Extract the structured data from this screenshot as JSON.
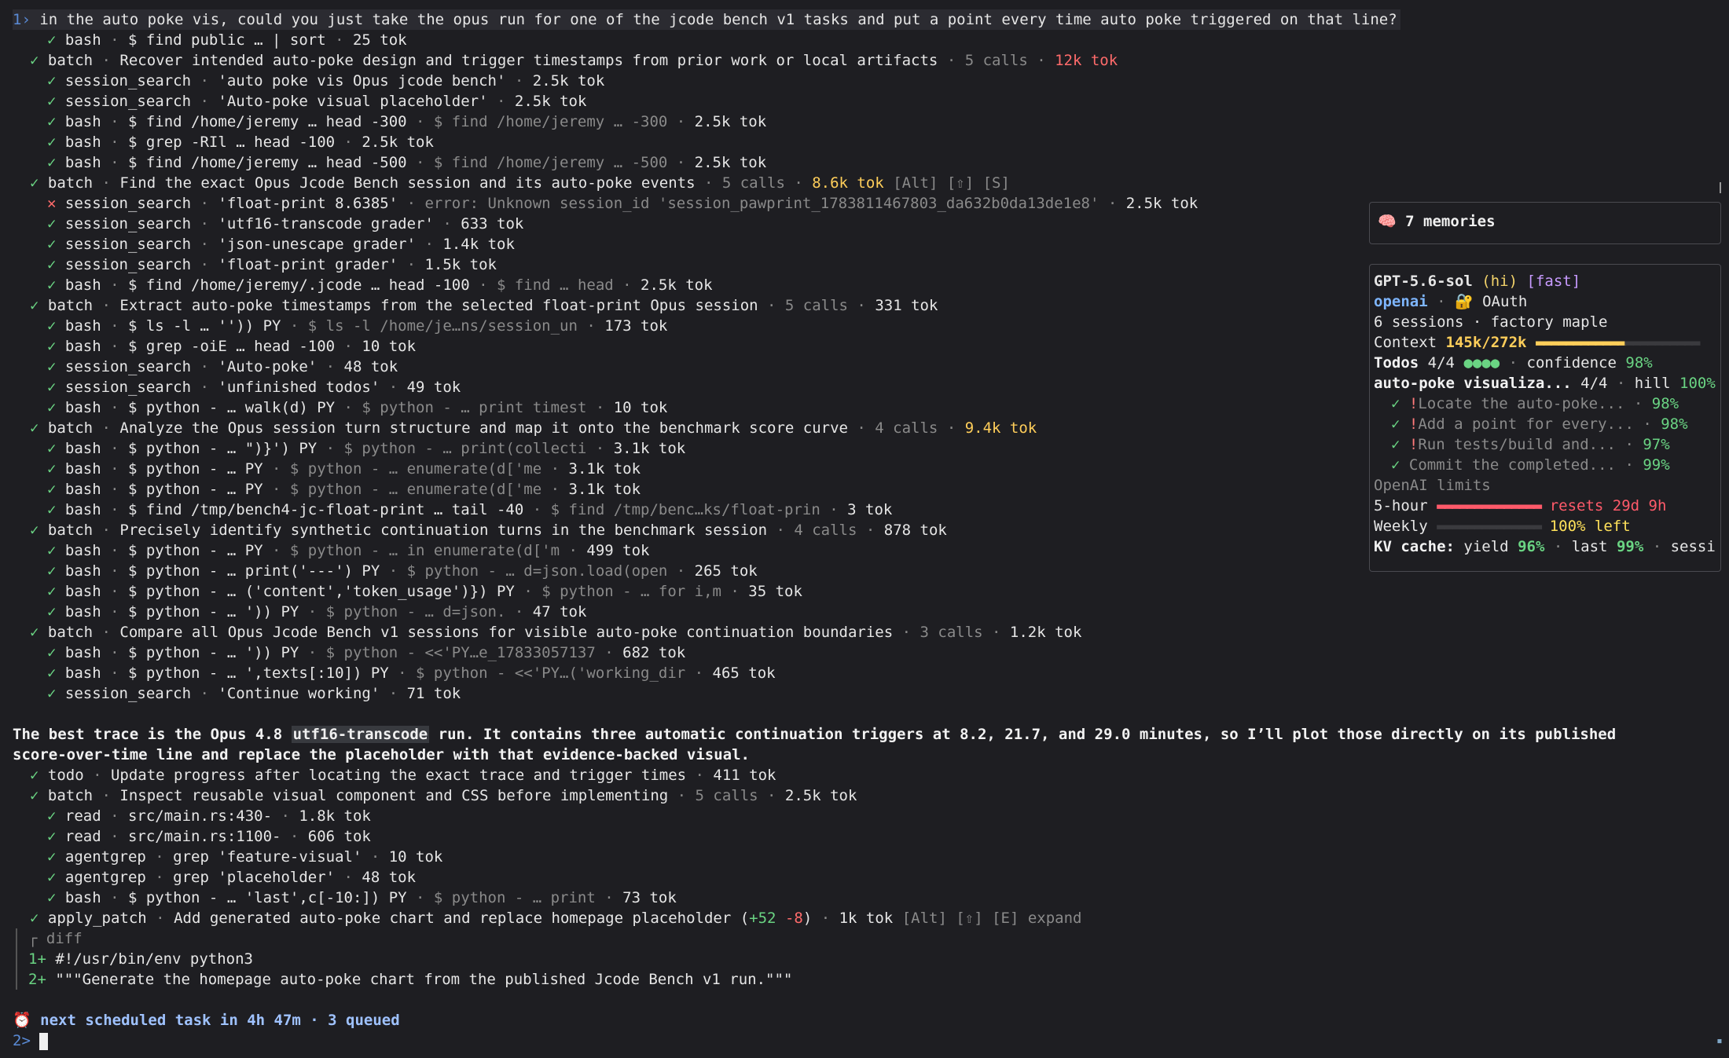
{
  "prompt": {
    "index": "1",
    "caret": "›",
    "text": "in the auto poke vis, could you just take the opus run for one of the jcode bench v1 tasks and put a point every time auto poke triggered on that line?"
  },
  "log": [
    {
      "d": 2,
      "s": "ok",
      "tool": "bash",
      "parts": [
        {
          "t": "$ find public … | sort"
        },
        {
          "t": " · ",
          "c": "dim"
        },
        {
          "t": "25 tok"
        }
      ]
    },
    {
      "d": 1,
      "s": "ok",
      "tool": "batch",
      "parts": [
        {
          "t": "Recover intended auto-poke design and trigger timestamps from prior work or local artifacts"
        },
        {
          "t": " · 5 calls · ",
          "c": "dim"
        },
        {
          "t": "12k tok",
          "c": "tokr"
        }
      ]
    },
    {
      "d": 2,
      "s": "ok",
      "tool": "session_search",
      "parts": [
        {
          "t": "'auto poke vis Opus jcode bench'"
        },
        {
          "t": " · ",
          "c": "dim"
        },
        {
          "t": "2.5k tok"
        }
      ]
    },
    {
      "d": 2,
      "s": "ok",
      "tool": "session_search",
      "parts": [
        {
          "t": "'Auto-poke visual placeholder'"
        },
        {
          "t": " · ",
          "c": "dim"
        },
        {
          "t": "2.5k tok"
        }
      ]
    },
    {
      "d": 2,
      "s": "ok",
      "tool": "bash",
      "parts": [
        {
          "t": "$ find /home/jeremy … head -300"
        },
        {
          "t": " · $ find /home/jeremy … -300 · ",
          "c": "dim"
        },
        {
          "t": "2.5k tok"
        }
      ]
    },
    {
      "d": 2,
      "s": "ok",
      "tool": "bash",
      "parts": [
        {
          "t": "$ grep -RIl … head -100"
        },
        {
          "t": " · ",
          "c": "dim"
        },
        {
          "t": "2.5k tok"
        }
      ]
    },
    {
      "d": 2,
      "s": "ok",
      "tool": "bash",
      "parts": [
        {
          "t": "$ find /home/jeremy … head -500"
        },
        {
          "t": " · $ find /home/jeremy … -500 · ",
          "c": "dim"
        },
        {
          "t": "2.5k tok"
        }
      ]
    },
    {
      "d": 1,
      "s": "ok",
      "tool": "batch",
      "parts": [
        {
          "t": "Find the exact Opus Jcode Bench session and its auto-poke events"
        },
        {
          "t": " · 5 calls · ",
          "c": "dim"
        },
        {
          "t": "8.6k tok",
          "c": "tokw"
        },
        {
          "t": " [Alt] [⇧] [S]",
          "c": "dim"
        }
      ]
    },
    {
      "d": 2,
      "s": "err",
      "tool": "session_search",
      "parts": [
        {
          "t": "'float-print 8.6385'"
        },
        {
          "t": " · error: Unknown session_id 'session_pawprint_1783811467803_da632b0da13de1e8' · ",
          "c": "dim"
        },
        {
          "t": "2.5k tok"
        }
      ]
    },
    {
      "d": 2,
      "s": "ok",
      "tool": "session_search",
      "parts": [
        {
          "t": "'utf16-transcode grader'"
        },
        {
          "t": " · ",
          "c": "dim"
        },
        {
          "t": "633 tok"
        }
      ]
    },
    {
      "d": 2,
      "s": "ok",
      "tool": "session_search",
      "parts": [
        {
          "t": "'json-unescape grader'"
        },
        {
          "t": " · ",
          "c": "dim"
        },
        {
          "t": "1.4k tok"
        }
      ]
    },
    {
      "d": 2,
      "s": "ok",
      "tool": "session_search",
      "parts": [
        {
          "t": "'float-print grader'"
        },
        {
          "t": " · ",
          "c": "dim"
        },
        {
          "t": "1.5k tok"
        }
      ]
    },
    {
      "d": 2,
      "s": "ok",
      "tool": "bash",
      "parts": [
        {
          "t": "$ find /home/jeremy/.jcode … head -100"
        },
        {
          "t": " · $ find … head · ",
          "c": "dim"
        },
        {
          "t": "2.5k tok"
        }
      ]
    },
    {
      "d": 1,
      "s": "ok",
      "tool": "batch",
      "parts": [
        {
          "t": "Extract auto-poke timestamps from the selected float-print Opus session"
        },
        {
          "t": " · 5 calls · ",
          "c": "dim"
        },
        {
          "t": "331 tok"
        }
      ]
    },
    {
      "d": 2,
      "s": "ok",
      "tool": "bash",
      "parts": [
        {
          "t": "$ ls -l … '')) PY"
        },
        {
          "t": " · $ ls -l /home/je…ns/session_un · ",
          "c": "dim"
        },
        {
          "t": "173 tok"
        }
      ]
    },
    {
      "d": 2,
      "s": "ok",
      "tool": "bash",
      "parts": [
        {
          "t": "$ grep -oiE … head -100"
        },
        {
          "t": " · ",
          "c": "dim"
        },
        {
          "t": "10 tok"
        }
      ]
    },
    {
      "d": 2,
      "s": "ok",
      "tool": "session_search",
      "parts": [
        {
          "t": "'Auto-poke'"
        },
        {
          "t": " · ",
          "c": "dim"
        },
        {
          "t": "48 tok"
        }
      ]
    },
    {
      "d": 2,
      "s": "ok",
      "tool": "session_search",
      "parts": [
        {
          "t": "'unfinished todos'"
        },
        {
          "t": " · ",
          "c": "dim"
        },
        {
          "t": "49 tok"
        }
      ]
    },
    {
      "d": 2,
      "s": "ok",
      "tool": "bash",
      "parts": [
        {
          "t": "$ python - … walk(d) PY"
        },
        {
          "t": " · $ python - … print timest · ",
          "c": "dim"
        },
        {
          "t": "10 tok"
        }
      ]
    },
    {
      "d": 1,
      "s": "ok",
      "tool": "batch",
      "parts": [
        {
          "t": "Analyze the Opus session turn structure and map it onto the benchmark score curve"
        },
        {
          "t": " · 4 calls · ",
          "c": "dim"
        },
        {
          "t": "9.4k tok",
          "c": "tokw"
        }
      ]
    },
    {
      "d": 2,
      "s": "ok",
      "tool": "bash",
      "parts": [
        {
          "t": "$ python - … \")}') PY"
        },
        {
          "t": " · $ python - … print(collecti · ",
          "c": "dim"
        },
        {
          "t": "3.1k tok"
        }
      ]
    },
    {
      "d": 2,
      "s": "ok",
      "tool": "bash",
      "parts": [
        {
          "t": "$ python - … PY"
        },
        {
          "t": " · $ python - … enumerate(d['me · ",
          "c": "dim"
        },
        {
          "t": "3.1k tok"
        }
      ]
    },
    {
      "d": 2,
      "s": "ok",
      "tool": "bash",
      "parts": [
        {
          "t": "$ python - … PY"
        },
        {
          "t": " · $ python - … enumerate(d['me · ",
          "c": "dim"
        },
        {
          "t": "3.1k tok"
        }
      ]
    },
    {
      "d": 2,
      "s": "ok",
      "tool": "bash",
      "parts": [
        {
          "t": "$ find /tmp/bench4-jc-float-print … tail -40"
        },
        {
          "t": " · $ find /tmp/benc…ks/float-prin · ",
          "c": "dim"
        },
        {
          "t": "3 tok"
        }
      ]
    },
    {
      "d": 1,
      "s": "ok",
      "tool": "batch",
      "parts": [
        {
          "t": "Precisely identify synthetic continuation turns in the benchmark session"
        },
        {
          "t": " · 4 calls · ",
          "c": "dim"
        },
        {
          "t": "878 tok"
        }
      ]
    },
    {
      "d": 2,
      "s": "ok",
      "tool": "bash",
      "parts": [
        {
          "t": "$ python - … PY"
        },
        {
          "t": " · $ python - … in enumerate(d['m · ",
          "c": "dim"
        },
        {
          "t": "499 tok"
        }
      ]
    },
    {
      "d": 2,
      "s": "ok",
      "tool": "bash",
      "parts": [
        {
          "t": "$ python - … print('---') PY"
        },
        {
          "t": " · $ python - … d=json.load(open · ",
          "c": "dim"
        },
        {
          "t": "265 tok"
        }
      ]
    },
    {
      "d": 2,
      "s": "ok",
      "tool": "bash",
      "parts": [
        {
          "t": "$ python - … ('content','token_usage')}) PY"
        },
        {
          "t": " · $ python - … for i,m · ",
          "c": "dim"
        },
        {
          "t": "35 tok"
        }
      ]
    },
    {
      "d": 2,
      "s": "ok",
      "tool": "bash",
      "parts": [
        {
          "t": "$ python - … ')) PY"
        },
        {
          "t": " · $ python - … d=json. · ",
          "c": "dim"
        },
        {
          "t": "47 tok"
        }
      ]
    },
    {
      "d": 1,
      "s": "ok",
      "tool": "batch",
      "parts": [
        {
          "t": "Compare all Opus Jcode Bench v1 sessions for visible auto-poke continuation boundaries"
        },
        {
          "t": " · 3 calls · ",
          "c": "dim"
        },
        {
          "t": "1.2k tok"
        }
      ]
    },
    {
      "d": 2,
      "s": "ok",
      "tool": "bash",
      "parts": [
        {
          "t": "$ python - … ')) PY"
        },
        {
          "t": " · $ python - <<'PY…e_17833057137 · ",
          "c": "dim"
        },
        {
          "t": "682 tok"
        }
      ]
    },
    {
      "d": 2,
      "s": "ok",
      "tool": "bash",
      "parts": [
        {
          "t": "$ python - … ',texts[:10]) PY"
        },
        {
          "t": " · $ python - <<'PY…('working_dir · ",
          "c": "dim"
        },
        {
          "t": "465 tok"
        }
      ]
    },
    {
      "d": 2,
      "s": "ok",
      "tool": "session_search",
      "parts": [
        {
          "t": "'Continue working'"
        },
        {
          "t": " · ",
          "c": "dim"
        },
        {
          "t": "71 tok"
        }
      ]
    }
  ],
  "message": {
    "before": "The best trace is the Opus 4.8 ",
    "code": "utf16-transcode",
    "after": " run. It contains three automatic continuation triggers at 8.2, 21.7, and 29.0 minutes, so I’ll plot those directly on its published",
    "line2": "score-over-time line and replace the placeholder with that evidence-backed visual."
  },
  "log2": [
    {
      "d": 1,
      "s": "ok",
      "tool": "todo",
      "parts": [
        {
          "t": "Update progress after locating the exact trace and trigger times"
        },
        {
          "t": " · ",
          "c": "dim"
        },
        {
          "t": "411 tok"
        }
      ]
    },
    {
      "d": 1,
      "s": "ok",
      "tool": "batch",
      "parts": [
        {
          "t": "Inspect reusable visual component and CSS before implementing"
        },
        {
          "t": " · 5 calls · ",
          "c": "dim"
        },
        {
          "t": "2.5k tok"
        }
      ]
    },
    {
      "d": 2,
      "s": "ok",
      "tool": "read",
      "parts": [
        {
          "t": "src/main.rs:430-"
        },
        {
          "t": " · ",
          "c": "dim"
        },
        {
          "t": "1.8k tok"
        }
      ]
    },
    {
      "d": 2,
      "s": "ok",
      "tool": "read",
      "parts": [
        {
          "t": "src/main.rs:1100-"
        },
        {
          "t": " · ",
          "c": "dim"
        },
        {
          "t": "606 tok"
        }
      ]
    },
    {
      "d": 2,
      "s": "ok",
      "tool": "agentgrep",
      "parts": [
        {
          "t": "grep 'feature-visual'"
        },
        {
          "t": " · ",
          "c": "dim"
        },
        {
          "t": "10 tok"
        }
      ]
    },
    {
      "d": 2,
      "s": "ok",
      "tool": "agentgrep",
      "parts": [
        {
          "t": "grep 'placeholder'"
        },
        {
          "t": " · ",
          "c": "dim"
        },
        {
          "t": "48 tok"
        }
      ]
    },
    {
      "d": 2,
      "s": "ok",
      "tool": "bash",
      "parts": [
        {
          "t": "$ python - … 'last',c[-10:]) PY"
        },
        {
          "t": " · $ python - … print · ",
          "c": "dim"
        },
        {
          "t": "73 tok"
        }
      ]
    },
    {
      "d": 1,
      "s": "ok",
      "tool": "apply_patch",
      "parts": [
        {
          "t": "Add generated auto-poke chart and replace homepage placeholder ("
        },
        {
          "t": "+52",
          "c": "gr"
        },
        {
          "t": " "
        },
        {
          "t": "-8",
          "c": "rd"
        },
        {
          "t": ")"
        },
        {
          "t": " · ",
          "c": "dim"
        },
        {
          "t": "1k tok"
        },
        {
          "t": " [Alt] [⇧] [E] expand",
          "c": "dim"
        }
      ]
    }
  ],
  "diff": {
    "label": "diff",
    "lines": [
      {
        "num": "1+",
        "code": "#!/usr/bin/env python3"
      },
      {
        "num": "2+",
        "code": "\"\"\"Generate the homepage auto-poke chart from the published Jcode Bench v1 run.\"\"\""
      }
    ]
  },
  "scheduled": {
    "icon": "⏰",
    "text": "next scheduled task in 4h 47m · 3 queued"
  },
  "input": {
    "index": "2>"
  },
  "memories": {
    "icon": "🧠",
    "label": "7 memories"
  },
  "stats": {
    "model": "GPT-5.6-sol",
    "effort": "(hi)",
    "speed": "[fast]",
    "provider": "openai",
    "auth_icon": "🔐",
    "auth": "OAuth",
    "sessions": "6 sessions · factory maple",
    "context_label": "Context",
    "context_value": "145k/272k",
    "context_fraction": 0.53,
    "todos_label": "Todos",
    "todos_count": "4/4",
    "todos_dots": "●●●●",
    "confidence_label": "confidence",
    "confidence": "98%",
    "goal": "auto-poke visualiza...",
    "goal_count": "4/4",
    "hill_label": "hill",
    "hill": "100%",
    "todos": [
      {
        "bang": "!",
        "label": "Locate the auto-poke...",
        "pct": "98%"
      },
      {
        "bang": "!",
        "label": "Add a point for every...",
        "pct": "98%"
      },
      {
        "bang": "!",
        "label": "Run tests/build and...",
        "pct": "97%"
      },
      {
        "bang": "",
        "label": "Commit the completed...",
        "pct": "99%"
      }
    ],
    "limits_title": "OpenAI limits",
    "five_hour_label": "5-hour",
    "five_hour_fraction": 1.0,
    "five_hour_reset": "resets 29d 9h",
    "weekly_label": "Weekly",
    "weekly_left": "100% left",
    "kv_label": "KV cache:",
    "kv_yield_label": "yield",
    "kv_yield": "96%",
    "kv_last_label": "last",
    "kv_last": "99%",
    "kv_tail": "sessi"
  },
  "colors": {
    "ok": "#6ad483",
    "err": "#ff6b6b",
    "warn": "#ffce5a",
    "bg": "#1e1e22"
  }
}
